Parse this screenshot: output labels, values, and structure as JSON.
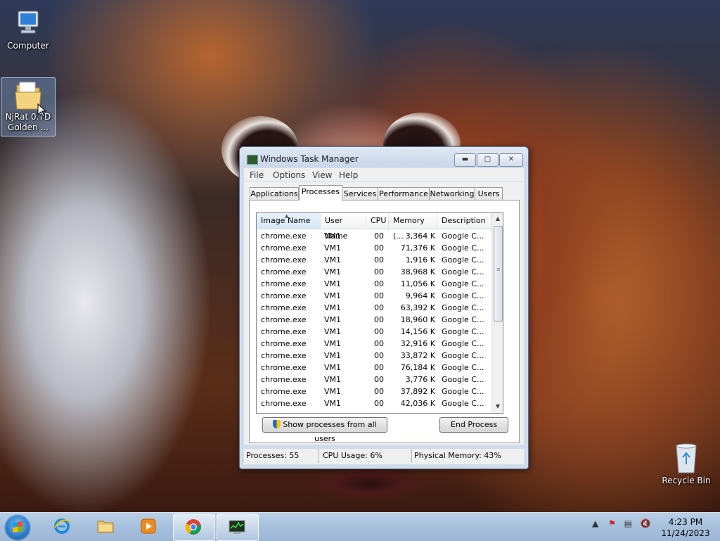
{
  "desktop": {
    "icons": [
      {
        "label": "Computer"
      },
      {
        "label_line1": "NjRat 0.7D",
        "label_line2": "Golden ..."
      },
      {
        "label": "Recycle Bin"
      }
    ]
  },
  "window": {
    "title": "Windows Task Manager",
    "menu": [
      "File",
      "Options",
      "View",
      "Help"
    ],
    "tabs": [
      "Applications",
      "Processes",
      "Services",
      "Performance",
      "Networking",
      "Users"
    ],
    "active_tab": "Processes",
    "columns": [
      "Image Name",
      "User Name",
      "CPU",
      "Memory (...",
      "Description"
    ],
    "rows": [
      {
        "image": "chrome.exe",
        "user": "VM1",
        "cpu": "00",
        "memory": "3,364 K",
        "desc": "Google C..."
      },
      {
        "image": "chrome.exe",
        "user": "VM1",
        "cpu": "00",
        "memory": "71,376 K",
        "desc": "Google C..."
      },
      {
        "image": "chrome.exe",
        "user": "VM1",
        "cpu": "00",
        "memory": "1,916 K",
        "desc": "Google C..."
      },
      {
        "image": "chrome.exe",
        "user": "VM1",
        "cpu": "00",
        "memory": "38,968 K",
        "desc": "Google C..."
      },
      {
        "image": "chrome.exe",
        "user": "VM1",
        "cpu": "00",
        "memory": "11,056 K",
        "desc": "Google C..."
      },
      {
        "image": "chrome.exe",
        "user": "VM1",
        "cpu": "00",
        "memory": "9,964 K",
        "desc": "Google C..."
      },
      {
        "image": "chrome.exe",
        "user": "VM1",
        "cpu": "00",
        "memory": "63,392 K",
        "desc": "Google C..."
      },
      {
        "image": "chrome.exe",
        "user": "VM1",
        "cpu": "00",
        "memory": "18,960 K",
        "desc": "Google C..."
      },
      {
        "image": "chrome.exe",
        "user": "VM1",
        "cpu": "00",
        "memory": "14,156 K",
        "desc": "Google C..."
      },
      {
        "image": "chrome.exe",
        "user": "VM1",
        "cpu": "00",
        "memory": "32,916 K",
        "desc": "Google C..."
      },
      {
        "image": "chrome.exe",
        "user": "VM1",
        "cpu": "00",
        "memory": "33,872 K",
        "desc": "Google C..."
      },
      {
        "image": "chrome.exe",
        "user": "VM1",
        "cpu": "00",
        "memory": "76,184 K",
        "desc": "Google C..."
      },
      {
        "image": "chrome.exe",
        "user": "VM1",
        "cpu": "00",
        "memory": "3,776 K",
        "desc": "Google C..."
      },
      {
        "image": "chrome.exe",
        "user": "VM1",
        "cpu": "00",
        "memory": "37,892 K",
        "desc": "Google C..."
      },
      {
        "image": "chrome.exe",
        "user": "VM1",
        "cpu": "00",
        "memory": "42,036 K",
        "desc": "Google C..."
      }
    ],
    "show_all_label": "Show processes from all users",
    "end_process_label": "End Process",
    "status": {
      "processes": "Processes: 55",
      "cpu": "CPU Usage: 6%",
      "memory": "Physical Memory: 43%"
    }
  },
  "taskbar": {
    "pinned": [
      "internet-explorer-icon",
      "file-explorer-icon",
      "media-player-icon",
      "chrome-icon",
      "task-manager-icon"
    ],
    "clock_time": "4:23 PM",
    "clock_date": "11/24/2023"
  },
  "colors": {
    "window_frame": "#cfdcec",
    "taskbar": "#a6c0dc"
  }
}
